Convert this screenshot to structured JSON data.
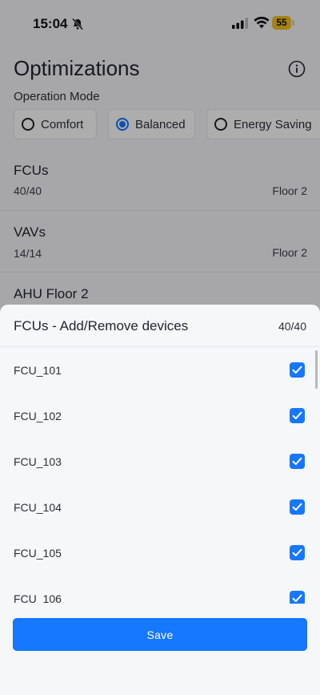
{
  "status_bar": {
    "time": "15:04",
    "battery": "55"
  },
  "page": {
    "title": "Optimizations",
    "operation_mode_label": "Operation Mode",
    "modes": [
      {
        "label": "Comfort",
        "selected": false
      },
      {
        "label": "Balanced",
        "selected": true
      },
      {
        "label": "Energy Saving",
        "selected": false
      }
    ],
    "groups": [
      {
        "title": "FCUs",
        "count": "40/40",
        "floor": "Floor 2"
      },
      {
        "title": "VAVs",
        "count": "14/14",
        "floor": "Floor 2"
      },
      {
        "title": "AHU Floor 2"
      }
    ]
  },
  "sheet": {
    "title": "FCUs - Add/Remove devices",
    "count": "40/40",
    "devices": [
      {
        "label": "FCU_101",
        "checked": true
      },
      {
        "label": "FCU_102",
        "checked": true
      },
      {
        "label": "FCU_103",
        "checked": true
      },
      {
        "label": "FCU_104",
        "checked": true
      },
      {
        "label": "FCU_105",
        "checked": true
      },
      {
        "label": "FCU_106",
        "checked": true
      }
    ],
    "save_label": "Save"
  },
  "colors": {
    "accent": "#1677ff",
    "battery": "#f4c21b"
  }
}
